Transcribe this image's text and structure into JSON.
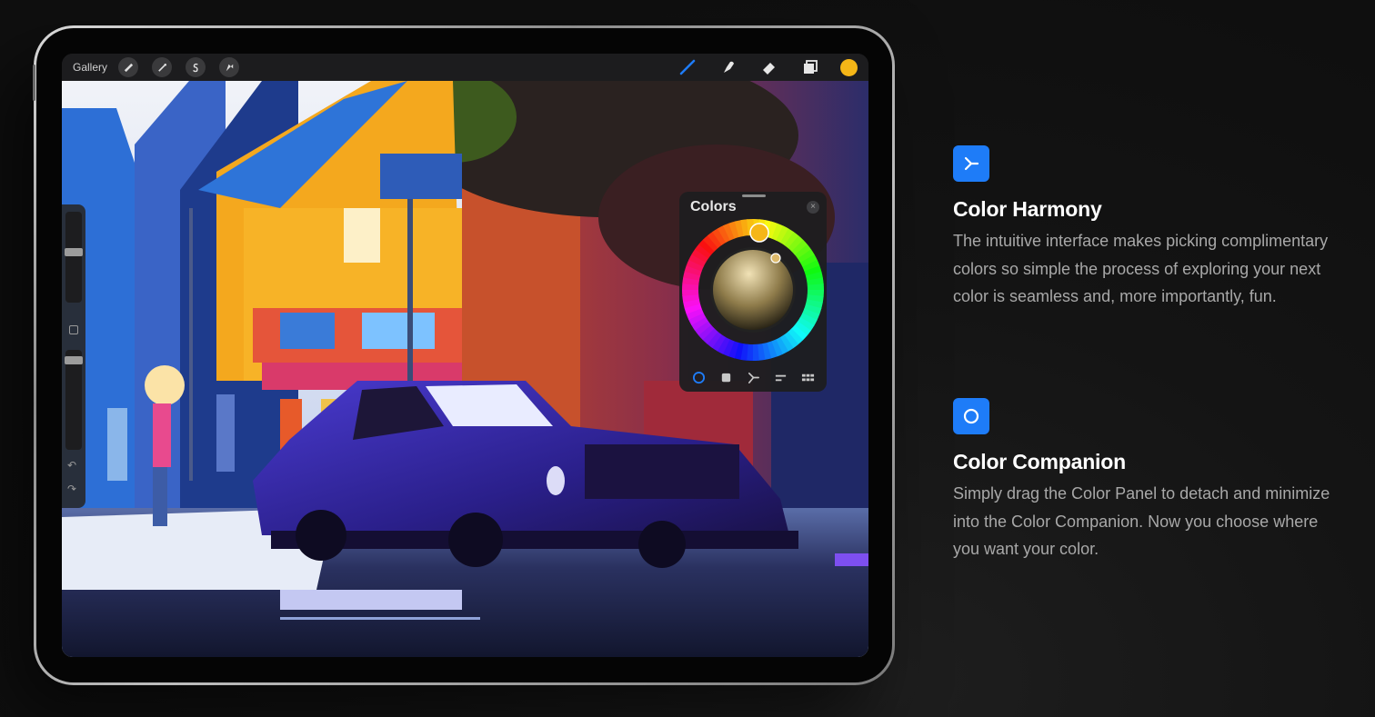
{
  "toolbar": {
    "gallery_label": "Gallery",
    "left_icons": [
      "wrench-icon",
      "magic-wand-icon",
      "selection-icon",
      "transform-arrow-icon"
    ],
    "right_icons": [
      "brush-icon",
      "smudge-icon",
      "eraser-icon",
      "layers-icon"
    ],
    "current_color": "#f5b617"
  },
  "colors_panel": {
    "title": "Colors",
    "close_glyph": "×",
    "tabs": [
      "disc-icon",
      "classic-icon",
      "harmony-icon",
      "value-icon",
      "palettes-icon"
    ],
    "active_tab": 0
  },
  "features": [
    {
      "icon": "harmony-icon",
      "title": "Color Harmony",
      "description": "The intuitive interface makes picking complimentary colors so simple the process of exploring your next color is seamless and, more importantly, fun."
    },
    {
      "icon": "disc-icon",
      "title": "Color Companion",
      "description": "Simply drag the Color Panel to detach and minimize into the Color Companion. Now you choose where you want your color."
    }
  ],
  "colors": {
    "accent": "#1e7cf8",
    "background": "#111111"
  }
}
